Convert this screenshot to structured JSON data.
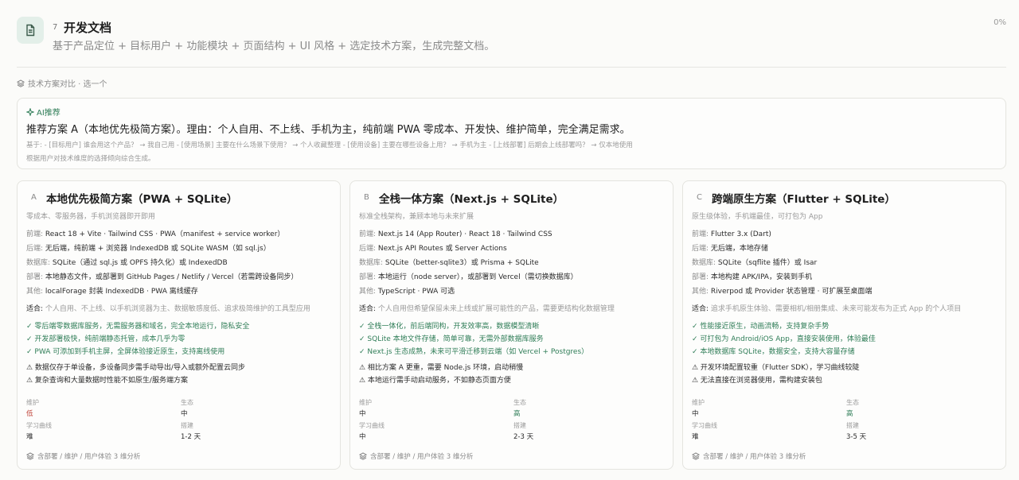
{
  "header": {
    "step_no": "7",
    "title": "开发文档",
    "subtitle": "基于产品定位 + 目标用户 + 功能模块 + 页面结构 + UI 风格 + 选定技术方案，生成完整文档。",
    "progress": "0%"
  },
  "section": {
    "label": "技术方案对比 · 选一个"
  },
  "ai": {
    "tag": "AI推荐",
    "main": "推荐方案 A（本地优先极简方案）。理由：个人自用、不上线、手机为主，纯前端 PWA 零成本、开发快、维护简单，完全满足需求。",
    "basis": "基于: - [目标用户] 谁会用这个产品？ → 我自己用 - [使用场景] 主要在什么场景下使用？ → 个人收藏整理 - [使用设备] 主要在哪些设备上用？ → 手机为主 - [上线部署] 后期会上线部署吗？ → 仅本地使用",
    "note": "根据用户对技术维度的选择倾向综合生成。"
  },
  "colors": {
    "accent": "#2f7d57",
    "low": "#c0453a",
    "icon_bg": "#e3efe9"
  },
  "cards": [
    {
      "letter": "A",
      "title": "本地优先极简方案（PWA + SQLite）",
      "desc": "零成本、零服务器，手机浏览器即开即用",
      "frontend_k": "前端:",
      "frontend": "React 18 + Vite · Tailwind CSS · PWA（manifest + service worker）",
      "backend_k": "后端:",
      "backend": "无后端，纯前端 + 浏览器 IndexedDB 或 SQLite WASM（如 sql.js）",
      "db_k": "数据库:",
      "db": "SQLite（通过 sql.js 或 OPFS 持久化）或 IndexedDB",
      "deploy_k": "部署:",
      "deploy": "本地静态文件，或部署到 GitHub Pages / Netlify / Vercel（若需跨设备同步）",
      "other_k": "其他:",
      "other": "localForage 封装 IndexedDB · PWA 离线缓存",
      "fit_k": "适合:",
      "fit": "个人自用、不上线、以手机浏览器为主、数据敏感度低、追求极简维护的工具型应用",
      "pros": [
        "✓ 零后端零数据库服务，无需服务器和域名，完全本地运行，隐私安全",
        "✓ 开发部署极快，纯前端静态托管，成本几乎为零",
        "✓ PWA 可添加到手机主屏，全屏体验接近原生，支持离线使用"
      ],
      "cons": [
        "⚠ 数据仅存于单设备，多设备同步需手动导出/导入或额外配置云同步",
        "⚠ 复杂查询和大量数据时性能不如原生/服务端方案"
      ],
      "m1_label": "维护",
      "m1": "低",
      "m2_label": "生态",
      "m2": "中",
      "m3_label": "学习曲线",
      "m3": "难",
      "m4_label": "搭建",
      "m4": "1-2 天",
      "foot": "含部署 / 维护 / 用户体验 3 维分析"
    },
    {
      "letter": "B",
      "title": "全栈一体方案（Next.js + SQLite）",
      "desc": "标准全栈架构，兼顾本地与未来扩展",
      "frontend_k": "前端:",
      "frontend": "Next.js 14 (App Router) · React 18 · Tailwind CSS",
      "backend_k": "后端:",
      "backend": "Next.js API Routes 或 Server Actions",
      "db_k": "数据库:",
      "db": "SQLite（better-sqlite3）或 Prisma + SQLite",
      "deploy_k": "部署:",
      "deploy": "本地运行（node server），或部署到 Vercel（需切换数据库）",
      "other_k": "其他:",
      "other": "TypeScript · PWA 可选",
      "fit_k": "适合:",
      "fit": "个人自用但希望保留未来上线或扩展可能性的产品，需要更结构化数据管理",
      "pros": [
        "✓ 全栈一体化，前后端同构，开发效率高，数据模型清晰",
        "✓ SQLite 本地文件存储，简单可靠，无需外部数据库服务",
        "✓ Next.js 生态成熟，未来可平滑迁移到云端（如 Vercel + Postgres）"
      ],
      "cons": [
        "⚠ 相比方案 A 更重，需要 Node.js 环境，启动稍慢",
        "⚠ 本地运行需手动启动服务，不如静态页面方便"
      ],
      "m1_label": "维护",
      "m1": "中",
      "m2_label": "生态",
      "m2": "高",
      "m3_label": "学习曲线",
      "m3": "中",
      "m4_label": "搭建",
      "m4": "2-3 天",
      "foot": "含部署 / 维护 / 用户体验 3 维分析"
    },
    {
      "letter": "C",
      "title": "跨端原生方案（Flutter + SQLite）",
      "desc": "原生级体验，手机端最佳，可打包为 App",
      "frontend_k": "前端:",
      "frontend": "Flutter 3.x (Dart)",
      "backend_k": "后端:",
      "backend": "无后端，本地存储",
      "db_k": "数据库:",
      "db": "SQLite（sqflite 插件）或 Isar",
      "deploy_k": "部署:",
      "deploy": "本地构建 APK/IPA，安装到手机",
      "other_k": "其他:",
      "other": "Riverpod 或 Provider 状态管理 · 可扩展至桌面端",
      "fit_k": "适合:",
      "fit": "追求手机原生体验、需要相机/相册集成、未来可能发布为正式 App 的个人项目",
      "pros": [
        "✓ 性能接近原生，动画流畅，支持复杂手势",
        "✓ 可打包为 Android/iOS App，直接安装使用，体验最佳",
        "✓ 本地数据库 SQLite，数据安全，支持大容量存储"
      ],
      "cons": [
        "⚠ 开发环境配置较重（Flutter SDK），学习曲线较陡",
        "⚠ 无法直接在浏览器使用，需构建安装包"
      ],
      "m1_label": "维护",
      "m1": "中",
      "m2_label": "生态",
      "m2": "高",
      "m3_label": "学习曲线",
      "m3": "难",
      "m4_label": "搭建",
      "m4": "3-5 天",
      "foot": "含部署 / 维护 / 用户体验 3 维分析"
    }
  ]
}
